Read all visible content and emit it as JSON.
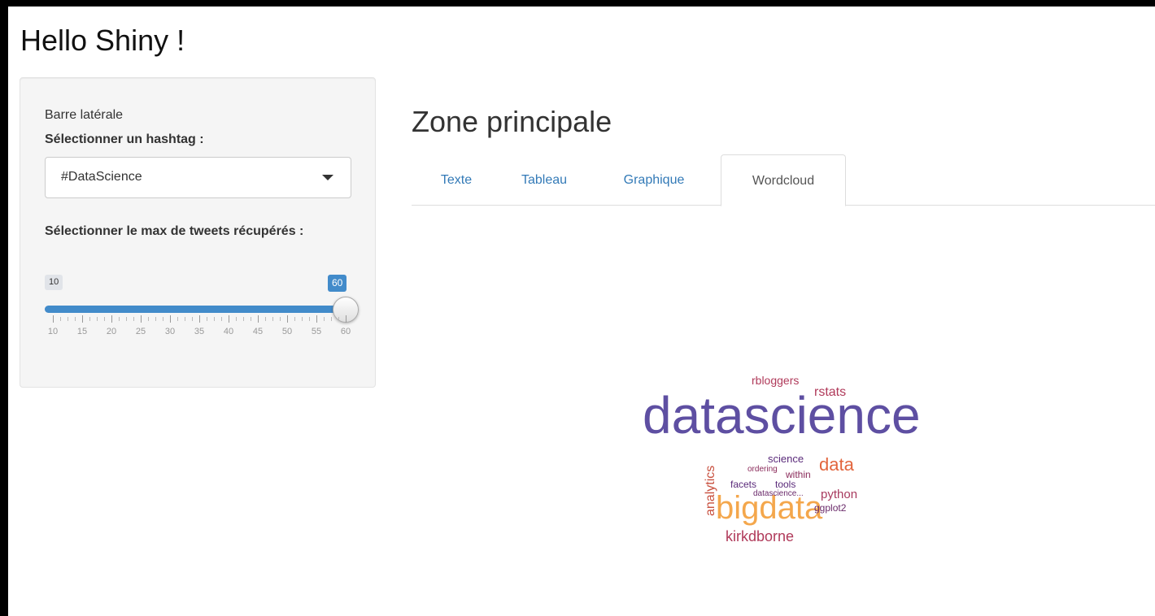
{
  "app": {
    "title": "Hello Shiny !"
  },
  "sidebar": {
    "heading": "Barre latérale",
    "hashtag_label": "Sélectionner un hashtag :",
    "hashtag_value": "#DataScience",
    "max_label": "Sélectionner le max de tweets récupérés :",
    "slider": {
      "min_badge": "10",
      "max_badge": "60",
      "value_fraction": 1.0,
      "ticks": [
        "10",
        "15",
        "20",
        "25",
        "30",
        "35",
        "40",
        "45",
        "50",
        "55",
        "60"
      ]
    }
  },
  "main": {
    "title": "Zone principale",
    "tabs": [
      {
        "label": "Texte"
      },
      {
        "label": "Tableau"
      },
      {
        "label": "Graphique"
      },
      {
        "label": "Wordcloud",
        "active": true
      }
    ]
  },
  "wordcloud": {
    "words": [
      {
        "text": "datascience",
        "color": "#5e4fa2"
      },
      {
        "text": "bigdata",
        "color": "#f4a74c"
      },
      {
        "text": "data",
        "color": "#e2653d"
      },
      {
        "text": "kirkdborne",
        "color": "#b03a5a"
      },
      {
        "text": "rbloggers",
        "color": "#b03a5a"
      },
      {
        "text": "rstats",
        "color": "#b03a5a"
      },
      {
        "text": "analytics",
        "color": "#c8503f"
      },
      {
        "text": "python",
        "color": "#a83a5e"
      },
      {
        "text": "science",
        "color": "#5a2a7a"
      },
      {
        "text": "ordering",
        "color": "#8a2a5a"
      },
      {
        "text": "within",
        "color": "#8a2a5a"
      },
      {
        "text": "facets",
        "color": "#5a2a7a"
      },
      {
        "text": "tools",
        "color": "#5a2a7a"
      },
      {
        "text": "datascience...",
        "color": "#6a2a6a"
      },
      {
        "text": "ggplot2",
        "color": "#6a2a6a"
      }
    ]
  }
}
